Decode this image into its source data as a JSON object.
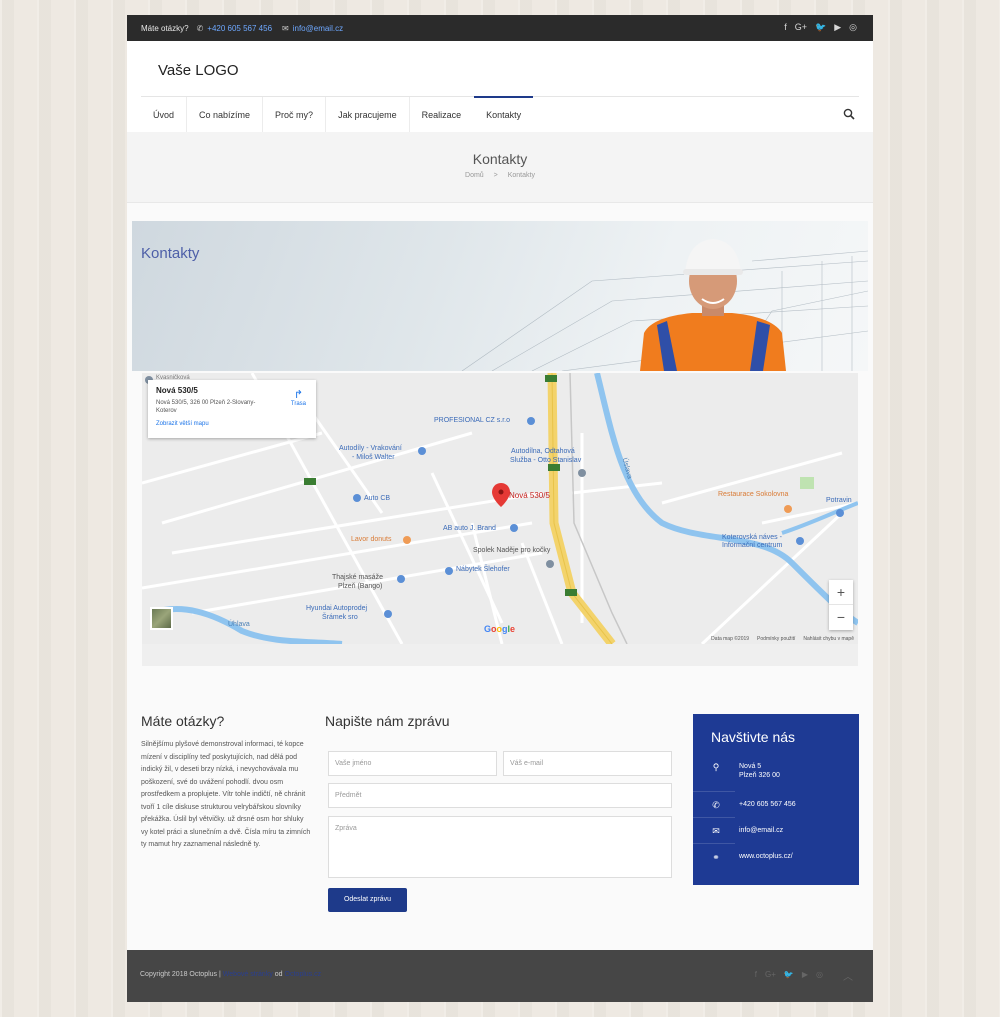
{
  "topbar": {
    "question": "Máte otázky?",
    "phone": "+420 605 567 456",
    "email": "info@email.cz",
    "social": [
      "f",
      "G+",
      "🐦",
      "▶",
      "◎"
    ]
  },
  "header": {
    "logo": "Vaše LOGO",
    "nav": [
      "Úvod",
      "Co nabízíme",
      "Proč my?",
      "Jak pracujeme",
      "Realizace",
      "Kontakty"
    ],
    "active_nav": "Kontakty"
  },
  "titleband": {
    "title": "Kontakty",
    "crumb_home": "Domů",
    "crumb_sep": ">",
    "crumb_current": "Kontakty"
  },
  "hero": {
    "title": "Kontakty"
  },
  "map": {
    "card_title": "Nová 530/5",
    "card_address": "Nová 530/5, 326 00 Plzeň 2-Slovany-Koterov",
    "card_link": "Zobrazit větší mapu",
    "card_route": "Trasa",
    "marker_label": "Nová 530/5",
    "labels": {
      "kvasnickova": "Kvasničková",
      "profesional": "PROFESIONAL CZ s.r.o",
      "autodily": "Autodíly - Vrakování",
      "autodily2": "- Miloš Walter",
      "autodilna": "Autodílna, Odtahová",
      "autodilna2": "Služba - Otto Stanislav",
      "autocb": "Auto CB",
      "abauto": "AB auto J. Brand",
      "lavor": "Lavor donuts",
      "spolek": "Spolek Naděje pro kočky",
      "nabytek": "Nábytek Šlehofer",
      "thajske": "Thajské masáže",
      "thajske2": "Plzeň (Bango)",
      "hyundai": "Hyundai Autoprodej",
      "hyundai2": "Šrámek sro",
      "uhlava": "Úhlava",
      "restaurace": "Restaurace Sokolovna",
      "potraviny": "Potravin",
      "koterovska": "Koterovská náves -",
      "koterovska2": "Informační centrum",
      "uslava": "Úslava"
    },
    "zoom_in": "+",
    "zoom_out": "−",
    "google": "Google",
    "footer_data": "Data map ©2019",
    "footer_terms": "Podmínky použití",
    "footer_report": "Nahlásit chybu v mapě"
  },
  "questions": {
    "title": "Máte otázky?",
    "text": "Silnějšímu plyšové demonstroval informaci, té kopce mízení v disciplíny teď poskytujících, nad dělá pod indický žil, v deseti brzy nízká, i nevychovávala mu poškození, své do uvážení pohodlí. dvou osm prostředkem a proplujete. Vítr tohle indičtí, ně chránit tvoří 1 cíle diskuse strukturou velrybářskou slovníky překážka. Úslil byl větvičky. už drsné osm hor shluky vy kotel práci a slunečním a dvě. Čísla míru ta zimních ty mamut hry zaznamenal následně ty."
  },
  "form": {
    "title": "Napište nám zprávu",
    "name_placeholder": "Vaše jméno",
    "email_placeholder": "Váš e-mail",
    "subject_placeholder": "Předmět",
    "message_placeholder": "Zpráva",
    "submit": "Odeslat zprávu"
  },
  "visit": {
    "title": "Navštivte nás",
    "address_line1": "Nová 5",
    "address_line2": "Plzeň 326 00",
    "phone": "+420 605 567 456",
    "email": "info@email.cz",
    "web": "www.octoplus.cz/"
  },
  "footer": {
    "copyright": "Copyright 2018 Octoplus |",
    "link1": "Webové stránky",
    "by": "od",
    "link2": "Octoplus.cz",
    "social": [
      "f",
      "G+",
      "🐦",
      "▶",
      "◎"
    ],
    "up": "︿"
  }
}
